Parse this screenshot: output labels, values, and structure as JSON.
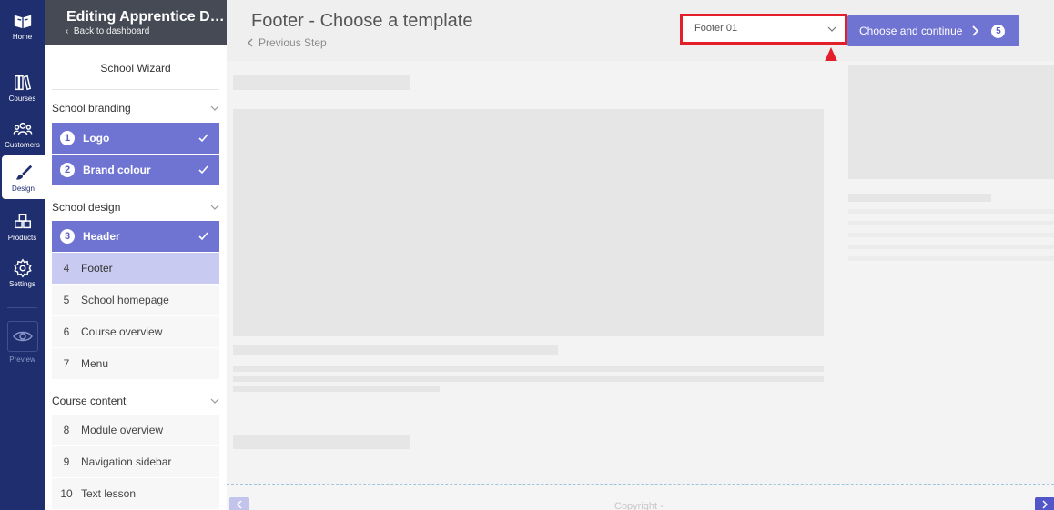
{
  "rail": {
    "home": "Home",
    "courses": "Courses",
    "customers": "Customers",
    "design": "Design",
    "products": "Products",
    "settings": "Settings",
    "preview": "Preview"
  },
  "sidebar": {
    "title": "Editing Apprentice D…",
    "back": "Back to dashboard",
    "wizard_title": "School Wizard",
    "sections": [
      {
        "label": "School branding"
      },
      {
        "label": "School design"
      },
      {
        "label": "Course content"
      }
    ],
    "steps": [
      {
        "num": "1",
        "label": "Logo",
        "state": "done"
      },
      {
        "num": "2",
        "label": "Brand colour",
        "state": "done"
      },
      {
        "num": "3",
        "label": "Header",
        "state": "done"
      },
      {
        "num": "4",
        "label": "Footer",
        "state": "current"
      },
      {
        "num": "5",
        "label": "School homepage",
        "state": "todo"
      },
      {
        "num": "6",
        "label": "Course overview",
        "state": "todo"
      },
      {
        "num": "7",
        "label": "Menu",
        "state": "todo"
      },
      {
        "num": "8",
        "label": "Module overview",
        "state": "todo"
      },
      {
        "num": "9",
        "label": "Navigation sidebar",
        "state": "todo"
      },
      {
        "num": "10",
        "label": "Text lesson",
        "state": "todo"
      }
    ]
  },
  "header": {
    "title": "Footer - Choose a template",
    "previous_step": "Previous Step",
    "template_select": "Footer 01",
    "continue_label": "Choose and continue",
    "continue_badge": "5"
  },
  "preview": {
    "copyright": "Copyright -"
  },
  "colors": {
    "rail": "#1f2e6e",
    "accent": "#6f73d2",
    "current_step": "#c9caf1",
    "highlight": "#e3202a"
  }
}
